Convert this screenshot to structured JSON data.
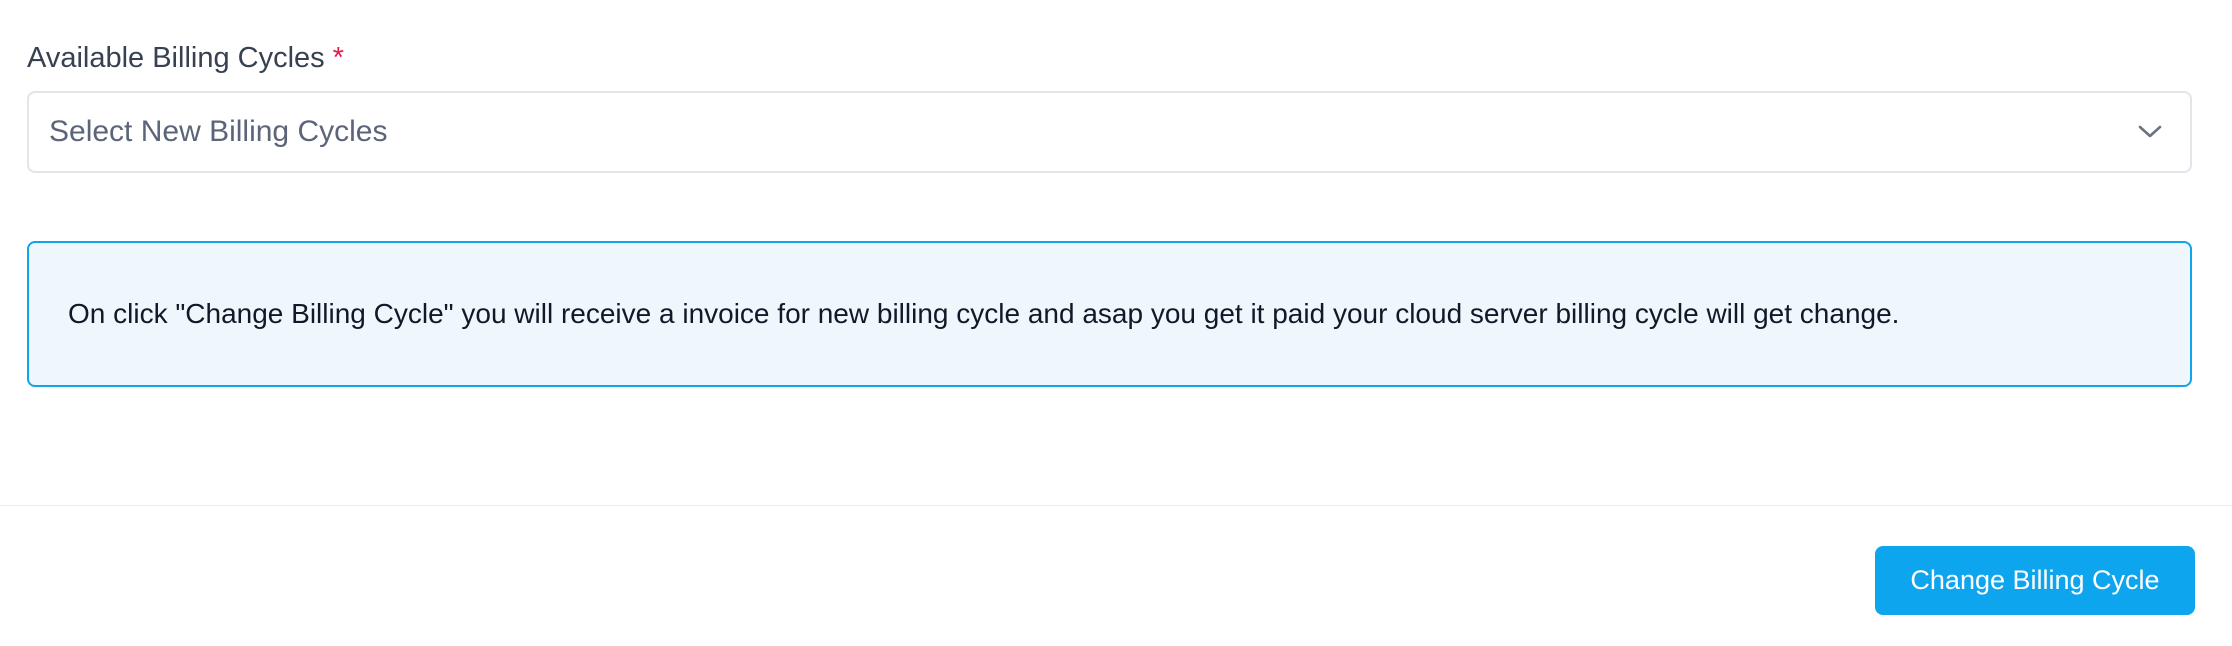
{
  "form": {
    "billing_cycles": {
      "label": "Available Billing Cycles",
      "required_marker": "*",
      "placeholder": "Select New Billing Cycles",
      "dropdown_icon": "chevron-down-icon"
    },
    "notice": {
      "text": "On click \"Change Billing Cycle\" you will receive a invoice for new billing cycle and asap you get it paid your cloud server billing cycle will get change."
    }
  },
  "footer": {
    "submit_label": "Change Billing Cycle"
  },
  "colors": {
    "accent": "#0ea5ef",
    "required": "#e11d48",
    "notice_border": "#0ea5e9",
    "notice_background": "#eff7fc"
  }
}
